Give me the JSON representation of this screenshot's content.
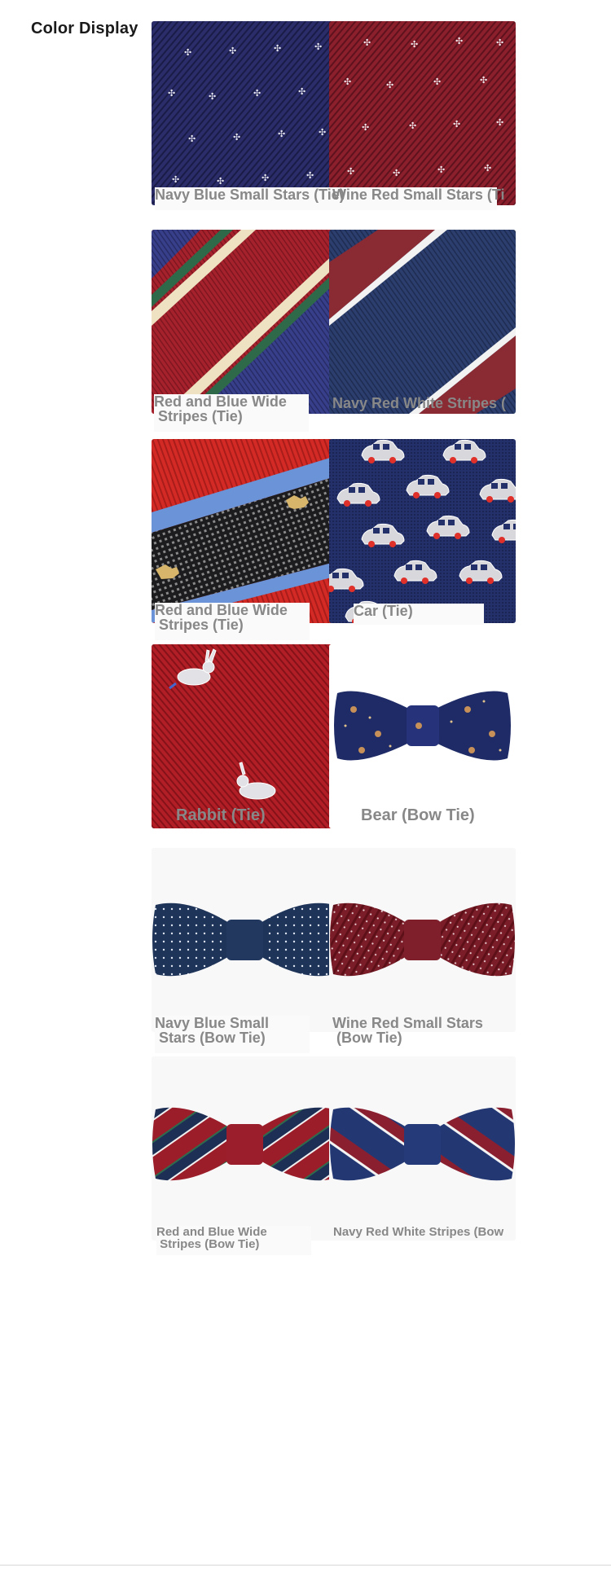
{
  "page": {
    "title": "Color Display"
  },
  "items": [
    {
      "label": "Navy Blue Small Stars (Tie)",
      "icon": "navy-small-stars-tie-swatch"
    },
    {
      "label": "Wine Red Small Stars (Ti",
      "icon": "wine-red-small-stars-tie-swatch"
    },
    {
      "label": "Red and Blue Wide\n Stripes (Tie)",
      "icon": "red-blue-wide-stripes-tie-swatch"
    },
    {
      "label": "Navy Red White Stripes (",
      "icon": "navy-red-white-stripes-tie-swatch"
    },
    {
      "label": "Red and Blue Wide\n Stripes (Tie)",
      "icon": "red-blue-wide-stripes-dog-tie-swatch"
    },
    {
      "label": "Car (Tie)",
      "icon": "car-tie-swatch"
    },
    {
      "label": "Rabbit (Tie)",
      "icon": "rabbit-tie-swatch"
    },
    {
      "label": "Bear (Bow Tie)",
      "icon": "bear-bow-tie-photo"
    },
    {
      "label": "Navy Blue Small\n Stars (Bow Tie)",
      "icon": "navy-small-stars-bow-tie-photo"
    },
    {
      "label": "Wine Red Small Stars\n (Bow Tie)",
      "icon": "wine-red-small-stars-bow-tie-photo"
    },
    {
      "label": "Red and Blue Wide\n Stripes (Bow Tie)",
      "icon": "red-blue-wide-stripes-bow-tie-photo"
    },
    {
      "label": "Navy Red White Stripes (Bow",
      "icon": "navy-red-white-stripes-bow-tie-photo"
    }
  ],
  "colors": {
    "navy": "#2d2f6b",
    "wine": "#8c1f2c",
    "caption": "#888888",
    "title": "#1a1a1a"
  }
}
